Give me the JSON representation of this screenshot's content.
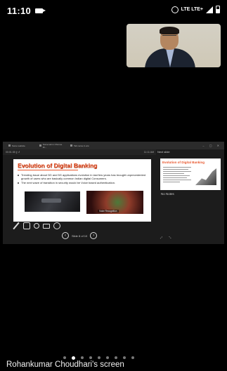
{
  "status_bar": {
    "time": "11:10",
    "network_label": "LTE LTE+"
  },
  "shared_screen": {
    "tabs": [
      "Some website",
      "Some tab in Chrome Dr...",
      "Tab name in ww"
    ],
    "presenter_bar_left": "00:01:35  ||  ↺",
    "presenter_bar_time": "11:11 AM",
    "next_slide_label": "Next slide",
    "slide": {
      "title": "Evolution of Digital Banking",
      "bullets": [
        "Trending issue about 5G and 5G applications evolution in last few years has brought unprecedented growth of users who are basically common Indian digital Consumers.",
        "The next wave of transition in security would be Voice based authentication."
      ],
      "image_caption": "Voice Recognition"
    },
    "thumbnail_title": "Evolution of Digital Banking",
    "notes_label": "No Notes",
    "slide_counter": "Slide 8 of 10",
    "notes_controls": "⤢ ⤡"
  },
  "page_indicator": {
    "count": 9,
    "active_index": 1
  },
  "footer": {
    "screen_owner": "Rohankumar Choudhari's screen"
  },
  "colors": {
    "slide_title": "#e8542a",
    "background": "#000000"
  }
}
